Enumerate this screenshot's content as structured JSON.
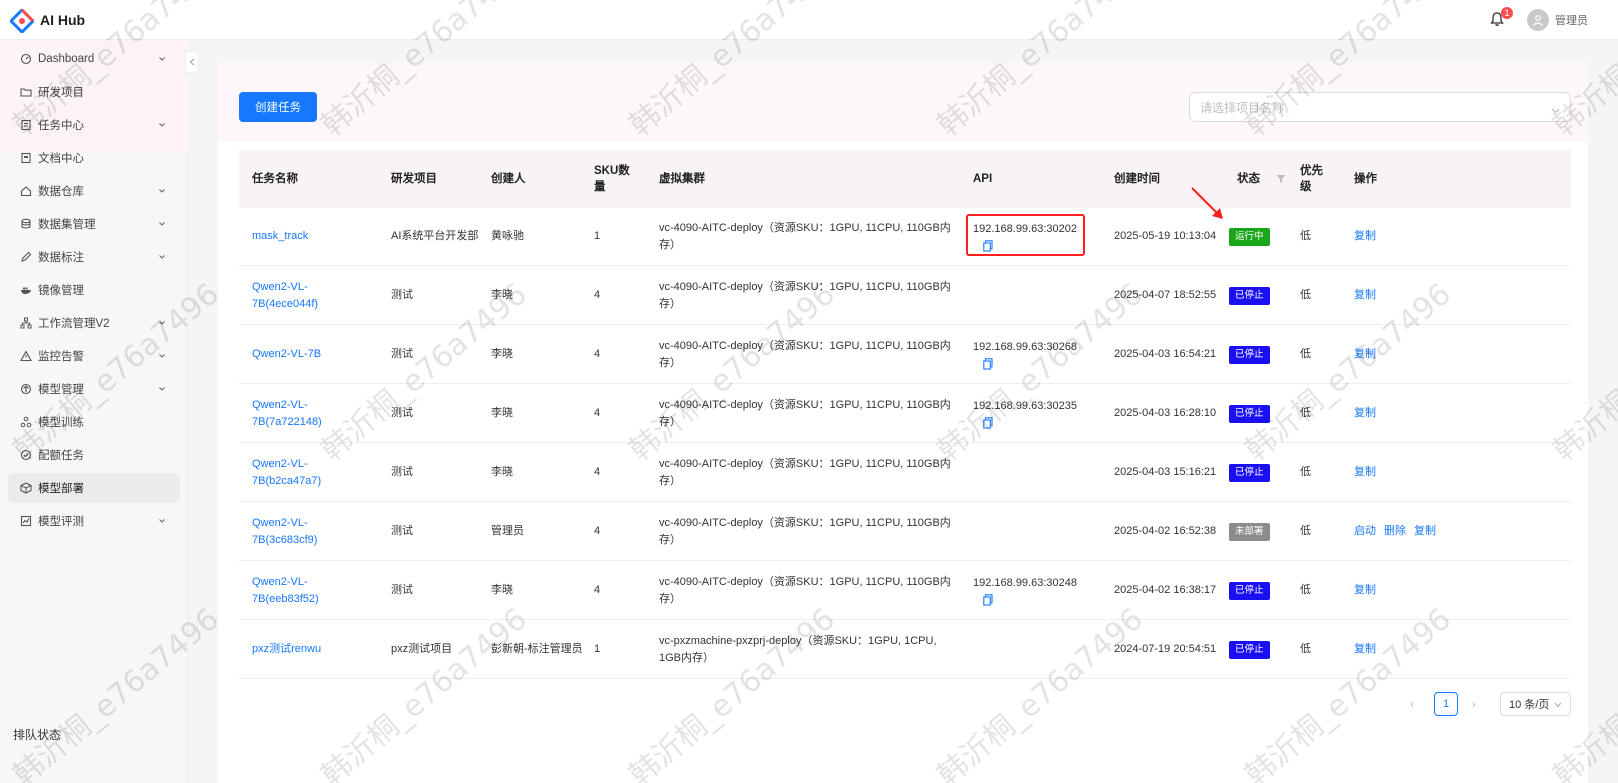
{
  "app": {
    "title": "AI Hub",
    "notification_count": "1",
    "user_name": "管理员",
    "accent": "#1677ff"
  },
  "sidebar": {
    "items": [
      {
        "label": "Dashboard",
        "icon": "dashboard-icon",
        "expandable": true
      },
      {
        "label": "研发项目",
        "icon": "folder-icon",
        "expandable": false
      },
      {
        "label": "任务中心",
        "icon": "task-icon",
        "expandable": true
      },
      {
        "label": "文档中心",
        "icon": "document-icon",
        "expandable": false
      },
      {
        "label": "数据仓库",
        "icon": "home-icon",
        "expandable": true
      },
      {
        "label": "数据集管理",
        "icon": "database-icon",
        "expandable": true
      },
      {
        "label": "数据标注",
        "icon": "pen-icon",
        "expandable": true
      },
      {
        "label": "镜像管理",
        "icon": "docker-icon",
        "expandable": false
      },
      {
        "label": "工作流管理V2",
        "icon": "workflow-icon",
        "expandable": true
      },
      {
        "label": "监控告警",
        "icon": "warning-icon",
        "expandable": true
      },
      {
        "label": "模型管理",
        "icon": "model-icon",
        "expandable": true
      },
      {
        "label": "模型训练",
        "icon": "training-icon",
        "expandable": false
      },
      {
        "label": "配额任务",
        "icon": "quota-icon",
        "expandable": false
      },
      {
        "label": "模型部署",
        "icon": "deploy-icon",
        "expandable": false,
        "active": true
      },
      {
        "label": "模型评测",
        "icon": "evaluate-icon",
        "expandable": true
      }
    ],
    "queue_status": "排队状态"
  },
  "toolbar": {
    "create_label": "创建任务",
    "project_select_placeholder": "请选择项目名称"
  },
  "table": {
    "columns": {
      "name": "任务名称",
      "project": "研发项目",
      "creator": "创建人",
      "sku": "SKU数量",
      "cluster": "虚拟集群",
      "api": "API",
      "created": "创建时间",
      "status": "状态",
      "priority": "优先级",
      "ops": "操作"
    },
    "rows": [
      {
        "name": "mask_track",
        "project": "AI系统平台开发部",
        "creator": "黄咏驰",
        "sku": "1",
        "cluster": "vc-4090-AITC-deploy（资源SKU：1GPU, 11CPU, 110GB内存）",
        "api": "192.168.99.63:30202",
        "created": "2025-05-19 10:13:04",
        "status": "运行中",
        "status_kind": "running",
        "priority": "低",
        "ops": [
          "复制"
        ]
      },
      {
        "name": "Qwen2-VL-7B(4ece044f)",
        "project": "测试",
        "creator": "李晓",
        "sku": "4",
        "cluster": "vc-4090-AITC-deploy（资源SKU：1GPU, 11CPU, 110GB内存）",
        "api": "",
        "created": "2025-04-07 18:52:55",
        "status": "已停止",
        "status_kind": "stopped",
        "priority": "低",
        "ops": [
          "复制"
        ]
      },
      {
        "name": "Qwen2-VL-7B",
        "project": "测试",
        "creator": "李晓",
        "sku": "4",
        "cluster": "vc-4090-AITC-deploy（资源SKU：1GPU, 11CPU, 110GB内存）",
        "api": "192.168.99.63:30268",
        "created": "2025-04-03 16:54:21",
        "status": "已停止",
        "status_kind": "stopped",
        "priority": "低",
        "ops": [
          "复制"
        ]
      },
      {
        "name": "Qwen2-VL-7B(7a722148)",
        "project": "测试",
        "creator": "李晓",
        "sku": "4",
        "cluster": "vc-4090-AITC-deploy（资源SKU：1GPU, 11CPU, 110GB内存）",
        "api": "192.168.99.63:30235",
        "created": "2025-04-03 16:28:10",
        "status": "已停止",
        "status_kind": "stopped",
        "priority": "低",
        "ops": [
          "复制"
        ]
      },
      {
        "name": "Qwen2-VL-7B(b2ca47a7)",
        "project": "测试",
        "creator": "李晓",
        "sku": "4",
        "cluster": "vc-4090-AITC-deploy（资源SKU：1GPU, 11CPU, 110GB内存）",
        "api": "",
        "created": "2025-04-03 15:16:21",
        "status": "已停止",
        "status_kind": "stopped",
        "priority": "低",
        "ops": [
          "复制"
        ]
      },
      {
        "name": "Qwen2-VL-7B(3c683cf9)",
        "project": "测试",
        "creator": "管理员",
        "sku": "4",
        "cluster": "vc-4090-AITC-deploy（资源SKU：1GPU, 11CPU, 110GB内存）",
        "api": "",
        "created": "2025-04-02 16:52:38",
        "status": "未部署",
        "status_kind": "undeployed",
        "priority": "低",
        "ops": [
          "启动",
          "删除",
          "复制"
        ]
      },
      {
        "name": "Qwen2-VL-7B(eeb83f52)",
        "project": "测试",
        "creator": "李晓",
        "sku": "4",
        "cluster": "vc-4090-AITC-deploy（资源SKU：1GPU, 11CPU, 110GB内存）",
        "api": "192.168.99.63:30248",
        "created": "2025-04-02 16:38:17",
        "status": "已停止",
        "status_kind": "stopped",
        "priority": "低",
        "ops": [
          "复制"
        ]
      },
      {
        "name": "pxz测试renwu",
        "project": "pxz测试项目",
        "creator": "彭新朝-标注管理员",
        "sku": "1",
        "cluster": "vc-pxzmachine-pxzprj-deploy（资源SKU：1GPU, 1CPU, 1GB内存）",
        "api": "",
        "created": "2024-07-19 20:54:51",
        "status": "已停止",
        "status_kind": "stopped",
        "priority": "低",
        "ops": [
          "复制"
        ]
      }
    ]
  },
  "pagination": {
    "current_page": "1",
    "page_size_label": "10 条/页"
  },
  "watermark": {
    "text": "韩沂桐_e76a7496"
  }
}
